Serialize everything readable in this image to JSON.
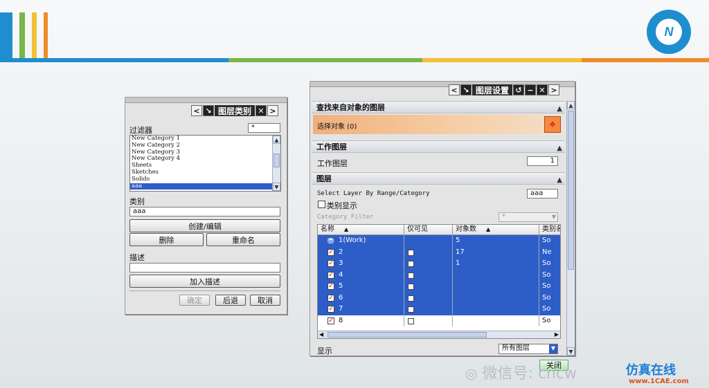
{
  "colors": {
    "accent_blue": "#1f8ecf",
    "green": "#7ab648",
    "yellow": "#f2c037",
    "orange": "#ee8b2b",
    "selection": "#2d5ec8",
    "highlight_orange": "#f0b07c"
  },
  "layer_category_dialog": {
    "title": "图层类别",
    "filter_label": "过滤器",
    "filter_value": "*",
    "categories": [
      "New Category 1",
      "New Category 2",
      "New Category 3",
      "New Category 4",
      "Sheets",
      "Sketches",
      "Solids",
      "aaa"
    ],
    "selected_category": "aaa",
    "category_label": "类别",
    "category_value": "aaa",
    "create_edit_button": "创建/编辑",
    "delete_button": "删除",
    "rename_button": "重命名",
    "description_label": "描述",
    "description_value": "",
    "add_description_button": "加入描述",
    "ok_button": "确定",
    "back_button": "后退",
    "cancel_button": "取消"
  },
  "layer_settings_dialog": {
    "title": "图层设置",
    "find_section": "查找来自对象的图层",
    "select_object": "选择对象 (0)",
    "work_layer_section": "工作图层",
    "work_layer_label": "工作图层",
    "work_layer_value": "1",
    "layers_section": "图层",
    "select_layer_label": "Select Layer By Range/Category",
    "select_layer_value": "aaa",
    "category_display_label": "类别显示",
    "category_filter_label": "Category Filter",
    "category_filter_value": "*",
    "columns": [
      "名称",
      "仅可见",
      "对象数",
      "类别名"
    ],
    "rows": [
      {
        "name": "1(Work)",
        "count": "5",
        "category": "So"
      },
      {
        "name": "2",
        "count": "17",
        "category": "Ne"
      },
      {
        "name": "3",
        "count": "1",
        "category": "So"
      },
      {
        "name": "4",
        "count": "",
        "category": "So"
      },
      {
        "name": "5",
        "count": "",
        "category": "So"
      },
      {
        "name": "6",
        "count": "",
        "category": "So"
      },
      {
        "name": "7",
        "count": "",
        "category": "So"
      },
      {
        "name": "8",
        "count": "",
        "category": "So"
      }
    ],
    "display_label": "显示",
    "display_value": "所有图层",
    "close_button": "关闭"
  },
  "watermark": {
    "wechat": "微信号: cncw",
    "site_cn": "仿真在线",
    "site_url": "www.1CAE.com"
  }
}
